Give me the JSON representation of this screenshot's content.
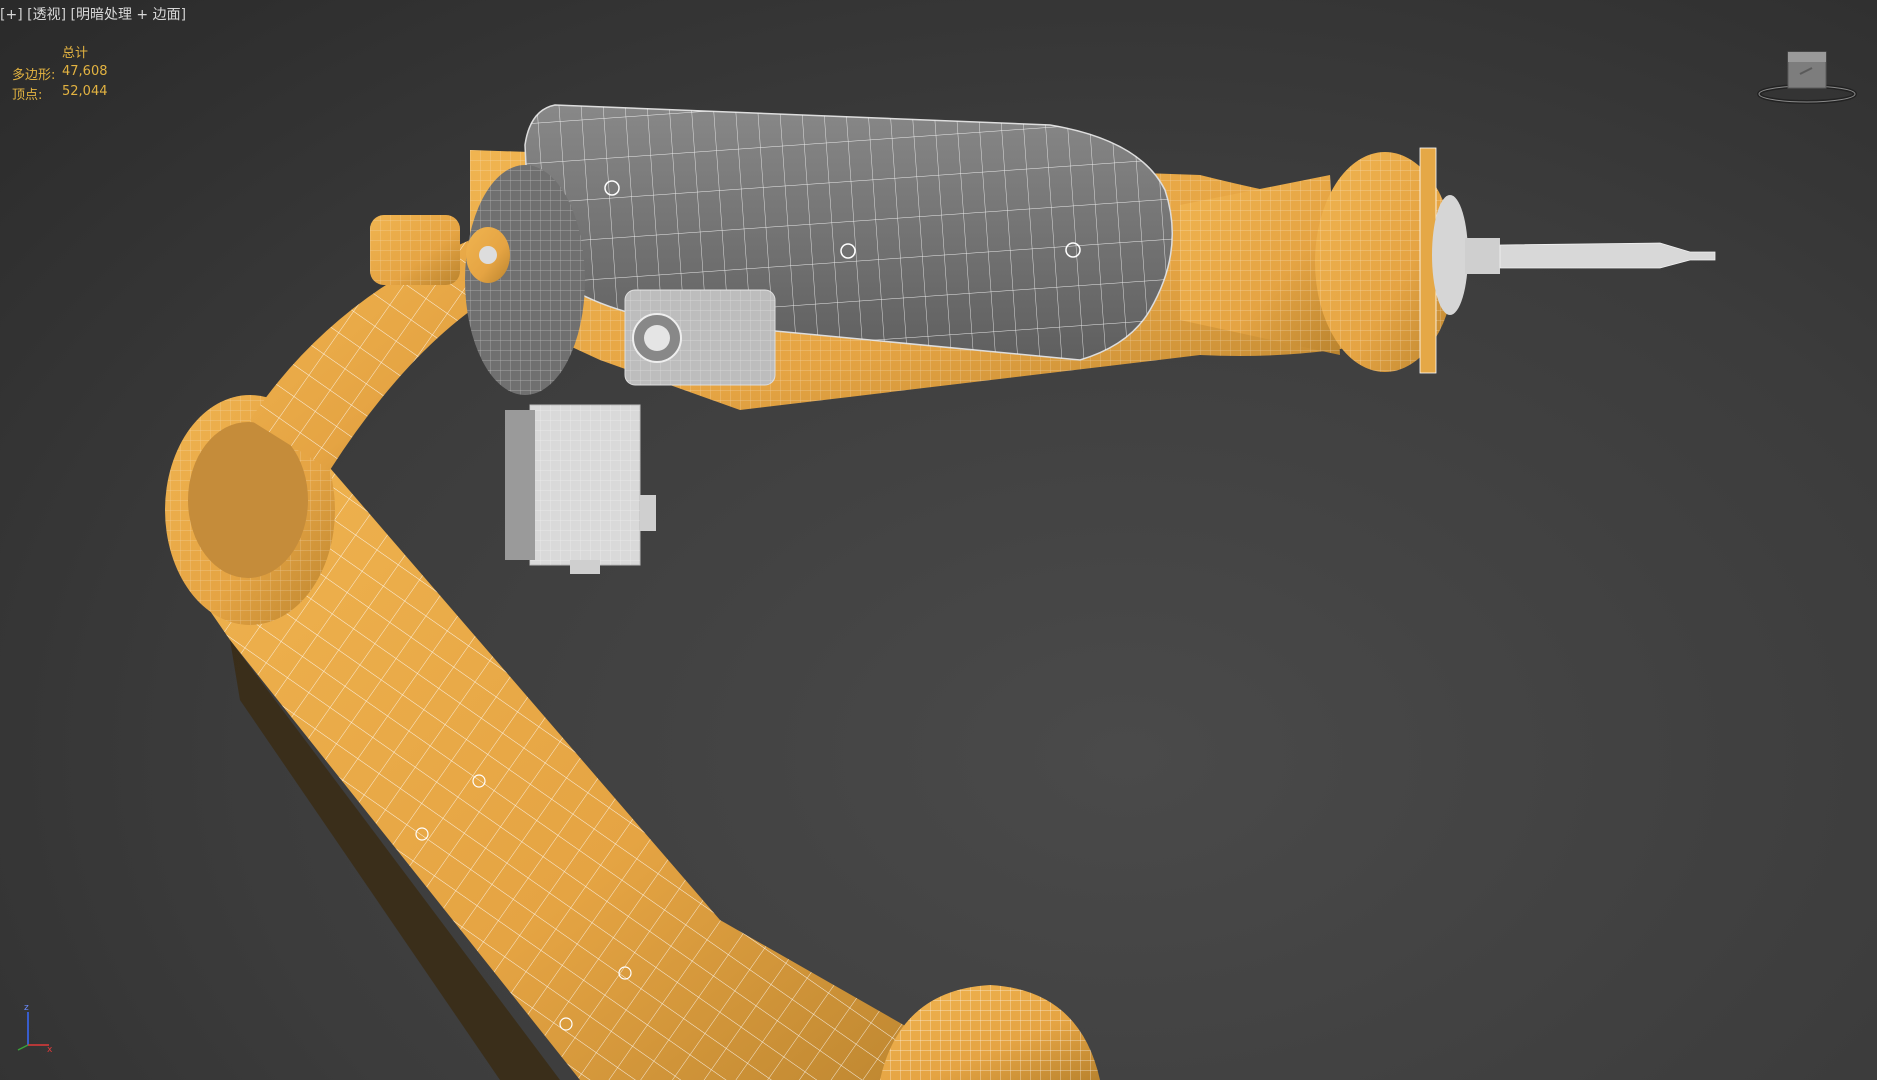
{
  "viewport": {
    "label_parts": {
      "plus": "+",
      "view": "透视",
      "shading": "明暗处理 + 边面"
    }
  },
  "stats": {
    "title": "总计",
    "polygons_label": "多边形:",
    "polygons_value": "47,608",
    "vertices_label": "顶点:",
    "vertices_value": "52,044"
  },
  "colors": {
    "background": "#3c3c3c",
    "model_orange": "#e5a846",
    "model_gray": "#7a7a7a",
    "stats_text": "#e3b341"
  },
  "icons": {
    "view_cube": "view-cube-icon",
    "axis_tripod": "axis-tripod-icon"
  }
}
